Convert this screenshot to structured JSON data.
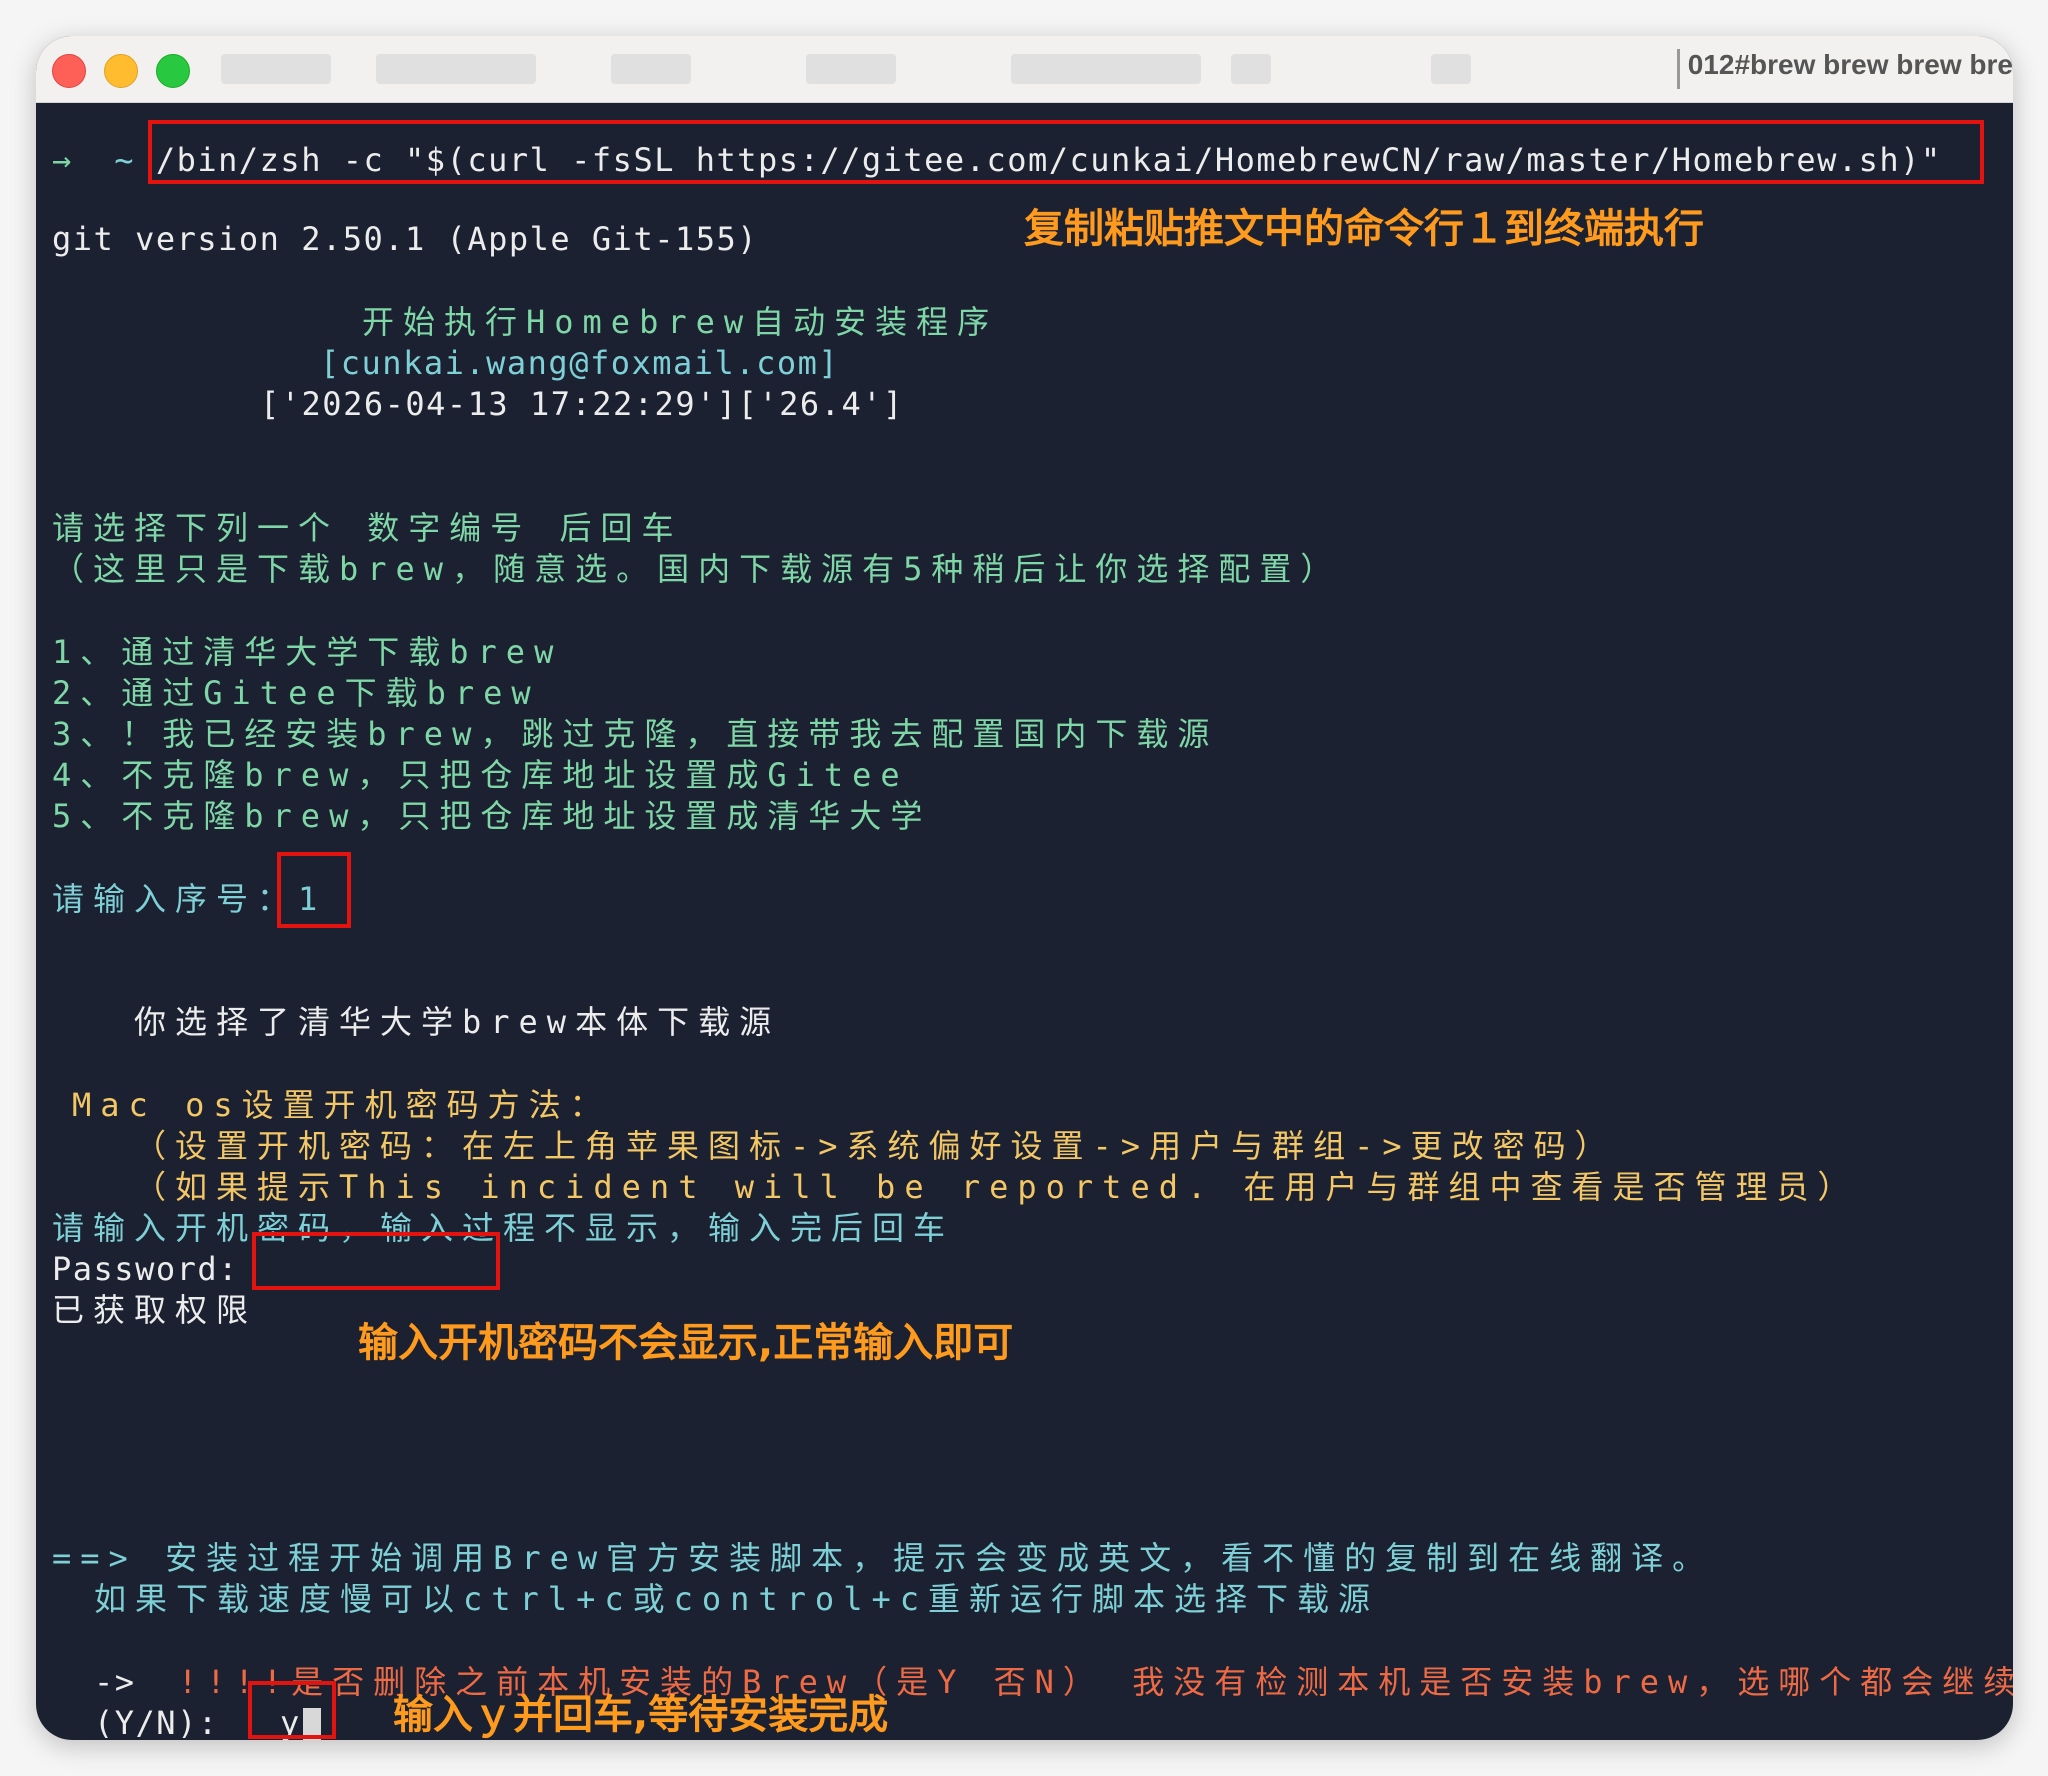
{
  "window": {
    "title": "012#brew brew brew bre"
  },
  "terminal": {
    "prompt_arrow": "→",
    "prompt_dir": "~",
    "command": "/bin/zsh -c \"$(curl -fsSL https://gitee.com/cunkai/HomebrewCN/raw/master/Homebrew.sh)\"",
    "git_version": "git version 2.50.1 (Apple Git-155)",
    "banner_1": "开始执行Homebrew自动安装程序",
    "banner_2": "[cunkai.wang@foxmail.com]",
    "banner_3": "['2026-04-13 17:22:29']['26.4']",
    "select_prompt": "请选择下列一个 数字编号 后回车",
    "select_note": "（这里只是下载brew，随意选。国内下载源有5种稍后让你选择配置）",
    "options": [
      "1、通过清华大学下载brew",
      "2、通过Gitee下载brew",
      "3、！我已经安装brew，跳过克隆，直接带我去配置国内下载源",
      "4、不克隆brew，只把仓库地址设置成Gitee",
      "5、不克隆brew，只把仓库地址设置成清华大学"
    ],
    "input_label": "请输入序号：",
    "input_value": "1",
    "chosen_message": "你选择了清华大学brew本体下载源",
    "mac_title": "Mac os设置开机密码方法：",
    "mac_hint_1": "（设置开机密码：在左上角苹果图标->系统偏好设置->用户与群组->更改密码）",
    "mac_hint_2": "（如果提示This incident will be reported. 在用户与群组中查看是否管理员）",
    "password_prompt": "请输入开机密码，输入过程不显示，输入完后回车",
    "password_label": "Password:",
    "granted": "已获取权限",
    "install_1": "==> 安装过程开始调用Brew官方安装脚本，提示会变成英文，看不懂的复制到在线翻译。",
    "install_2": "如果下载速度慢可以ctrl+c或control+c重新运行脚本选择下载源",
    "delete_arrow": "->",
    "delete_question": "!!!!是否删除之前本机安装的Brew（是Y 否N） 我没有检测本机是否安装brew，选哪个都会继续运行",
    "yn_label": "(Y/N):",
    "yn_value": "y"
  },
  "annotations": {
    "step1": "复制粘贴推文中的命令行１到终端执行",
    "step2": "输入开机密码不会显示,正常输入即可",
    "step3": "输入ｙ并回车,等待安装完成"
  },
  "colors": {
    "terminal_bg": "#1b2130",
    "highlight_box": "#e3140f",
    "annotation": "#fe9a1d",
    "green_text": "#7fd6a6",
    "cyan_text": "#7fd0d6",
    "yellow_text": "#f4c766",
    "red_text": "#ee6a45"
  }
}
